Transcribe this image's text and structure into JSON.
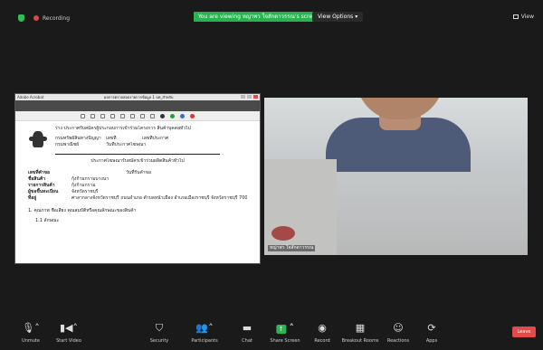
{
  "topbar": {
    "recording_label": "Recording",
    "viewing_text": "You are viewing หญ่าพว ใจสักดาวรรณ's screen",
    "view_options_label": "View Options ▾",
    "view_label": "View"
  },
  "shared_screen": {
    "app_title": "Adobe Acrobat",
    "doc_title": "ผลการตรวจสอบรายการข้อมูล 1 บท_สำหรับ",
    "doc": {
      "heading": "ร่าง ประกาศรับสมัครผู้ประกอบการเข้าร่วมโครงการ สินค้าบุคคลทั่วไป",
      "l2_a": "กรมทรัพย์สินทางปัญญา",
      "l2_b": "เลขที่",
      "l2_c": "เลขที่ประกาศ",
      "l3_a": "กรมพาณิชย์",
      "l3_b": "วันที่ประกาศโฆษณา",
      "subtitle": "ประกาศโฆษณารับสมัครเข้าร่วมผลิตสินค้าทั่วไป",
      "f1_label": "เลขที่คำขอ",
      "f1_value": "วันที่รับคำขอ",
      "f2_label": "ชื่อสินค้า",
      "f2_value": "กุ้งก้ามกรามบางนา",
      "f3_label": "รายการสินค้า",
      "f3_value": "กุ้งก้ามกราม",
      "f4_label": "ผู้ขอขึ้นทะเบียน",
      "f4_value": "จังหวัดราชบุรี",
      "f5_label": "ที่อยู่",
      "f5_value": "ศาลากลางจังหวัดราชบุรี ถนนอำเภอ ตำบลหน้าเมือง อำเภอเมืองราชบุรี จังหวัดราชบุรี 70000",
      "section1": "1. คุณภาพ ชื่อเสียง คุณสมบัติหรือคุณลักษณะของสินค้า",
      "section1_1": "1.1 ลักษณะ"
    }
  },
  "video": {
    "participant_name": "หญ่าพว ใจสักดาวรรณ"
  },
  "toolbar": {
    "items": [
      {
        "label": "Unmute",
        "icon": "mic-muted-icon"
      },
      {
        "label": "Start Video",
        "icon": "video-off-icon"
      },
      {
        "label": "Security",
        "icon": "shield-icon"
      },
      {
        "label": "Participants",
        "icon": "participants-icon"
      },
      {
        "label": "Chat",
        "icon": "chat-icon"
      },
      {
        "label": "Share Screen",
        "icon": "share-screen-icon"
      },
      {
        "label": "Record",
        "icon": "record-icon"
      },
      {
        "label": "Breakout Rooms",
        "icon": "breakout-rooms-icon"
      },
      {
        "label": "Reactions",
        "icon": "reactions-icon"
      },
      {
        "label": "Apps",
        "icon": "apps-icon"
      }
    ],
    "leave_label": "Leave"
  },
  "colors": {
    "accent_green": "#2db553",
    "leave_red": "#e34a4a",
    "background": "#1a1a1a"
  }
}
